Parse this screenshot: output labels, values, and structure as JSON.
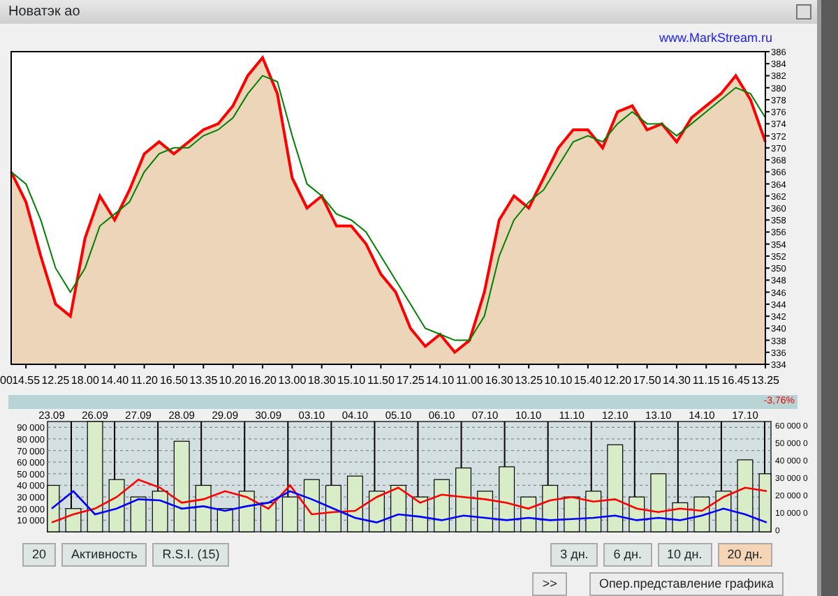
{
  "window": {
    "title": "Новатэк ао"
  },
  "source_link": "www.MarkStream.ru",
  "price_chart": {
    "cut_label": "00",
    "chart_data": {
      "type": "area",
      "categories": [
        null,
        "14.55",
        null,
        "12.25",
        null,
        "18.00",
        null,
        "14.40",
        null,
        "11.20",
        null,
        "16.50",
        null,
        "13.35",
        null,
        "10.20",
        null,
        "16.20",
        null,
        "13.00",
        null,
        "18.30",
        null,
        "15.10",
        null,
        "11.50",
        null,
        "17.25",
        null,
        "14.10",
        null,
        "11.00",
        null,
        "16.30",
        null,
        "13.25",
        null,
        "10.10",
        null,
        "15.40",
        null,
        "12.20",
        null,
        "17.50",
        null,
        "14.30",
        null,
        "11.15",
        null,
        "16.45",
        null,
        "13.25"
      ],
      "series": [
        {
          "type": "area",
          "color": "#ff0000",
          "values": [
            366,
            361,
            352,
            344,
            342,
            355,
            362,
            358,
            363,
            369,
            371,
            369,
            371,
            373,
            374,
            377,
            382,
            385,
            379,
            365,
            360,
            362,
            357,
            357,
            354,
            349,
            346,
            340,
            337,
            339,
            336,
            338,
            346,
            358,
            362,
            360,
            365,
            370,
            373,
            373,
            370,
            376,
            377,
            373,
            374,
            371,
            375,
            377,
            379,
            382,
            378,
            371
          ]
        },
        {
          "type": "line",
          "color": "#008000",
          "values": [
            366,
            364,
            358,
            350,
            346,
            350,
            357,
            359,
            361,
            366,
            369,
            370,
            370,
            372,
            373,
            375,
            379,
            382,
            381,
            372,
            364,
            362,
            359,
            358,
            356,
            352,
            348,
            344,
            340,
            339,
            338,
            338,
            342,
            352,
            358,
            361,
            363,
            367,
            371,
            372,
            371,
            374,
            376,
            374,
            374,
            372,
            374,
            376,
            378,
            380,
            379,
            375
          ]
        }
      ],
      "ylim": [
        334,
        386
      ],
      "yticks": [
        334,
        336,
        338,
        340,
        342,
        344,
        346,
        348,
        350,
        352,
        354,
        356,
        358,
        360,
        362,
        364,
        366,
        368,
        370,
        372,
        374,
        376,
        378,
        380,
        382,
        384,
        386
      ]
    }
  },
  "change_label": "-3,76%",
  "volume_panel": {
    "chart_data": {
      "type": "bar",
      "grid": true,
      "categories": [
        "23.09",
        null,
        "26.09",
        null,
        "27.09",
        null,
        "28.09",
        null,
        "29.09",
        null,
        "30.09",
        null,
        "03.10",
        null,
        "04.10",
        null,
        "05.10",
        null,
        "06.10",
        null,
        "07.10",
        null,
        "10.10",
        null,
        "11.10",
        null,
        "12.10",
        null,
        "13.10",
        null,
        "14.10",
        null,
        "17.10",
        null
      ],
      "series": [
        {
          "type": "bar",
          "color": "#d8ecc8",
          "values": [
            40000,
            20000,
            95000,
            45000,
            30000,
            35000,
            78000,
            40000,
            20000,
            35000,
            25000,
            30000,
            45000,
            40000,
            48000,
            35000,
            40000,
            30000,
            45000,
            55000,
            35000,
            56000,
            30000,
            40000,
            30000,
            35000,
            75000,
            30000,
            50000,
            25000,
            30000,
            35000,
            62000,
            50000
          ]
        },
        {
          "type": "line",
          "color": "#ff0000",
          "values": [
            8000,
            15000,
            20000,
            30000,
            45000,
            38000,
            25000,
            28000,
            35000,
            30000,
            20000,
            40000,
            15000,
            17000,
            18000,
            30000,
            38000,
            25000,
            32000,
            30000,
            28000,
            25000,
            20000,
            27000,
            30000,
            26000,
            28000,
            20000,
            17000,
            20000,
            18000,
            30000,
            38000,
            35000
          ]
        },
        {
          "type": "line",
          "color": "#0000ff",
          "values": [
            20000,
            35000,
            15000,
            20000,
            28000,
            27000,
            20000,
            22000,
            18000,
            22000,
            25000,
            35000,
            28000,
            20000,
            12000,
            8000,
            15000,
            13000,
            10000,
            14000,
            12000,
            10000,
            12000,
            10000,
            11000,
            12000,
            14000,
            10000,
            12000,
            10000,
            14000,
            20000,
            15000,
            8000
          ]
        }
      ],
      "ylim": [
        0,
        95000
      ],
      "yticks": [
        {
          "value": 90000,
          "label": "90 000"
        },
        {
          "value": 80000,
          "label": "80 000"
        },
        {
          "value": 70000,
          "label": "70 000"
        },
        {
          "value": 60000,
          "label": "60 000"
        },
        {
          "value": 50000,
          "label": "50 000"
        },
        {
          "value": 40000,
          "label": "40 000"
        },
        {
          "value": 30000,
          "label": "30 000"
        },
        {
          "value": 20000,
          "label": "20 000"
        },
        {
          "value": 10000,
          "label": "10 000"
        }
      ]
    },
    "right_axis": [
      "60 000 0",
      "50 000 0",
      "40 000 0",
      "30 000 0",
      "20 000 0",
      "10 000 0",
      "0"
    ]
  },
  "indicator_buttons": [
    {
      "label": "20"
    },
    {
      "label": "Активность"
    },
    {
      "label": "R.S.I.  (15)"
    }
  ],
  "period_buttons": [
    {
      "label": "3 дн.",
      "selected": false
    },
    {
      "label": "6 дн.",
      "selected": false
    },
    {
      "label": "10 дн.",
      "selected": false
    },
    {
      "label": "20 дн.",
      "selected": true
    }
  ],
  "action_buttons": [
    {
      "label": ">>"
    },
    {
      "label": "Опер.представление графика"
    }
  ]
}
